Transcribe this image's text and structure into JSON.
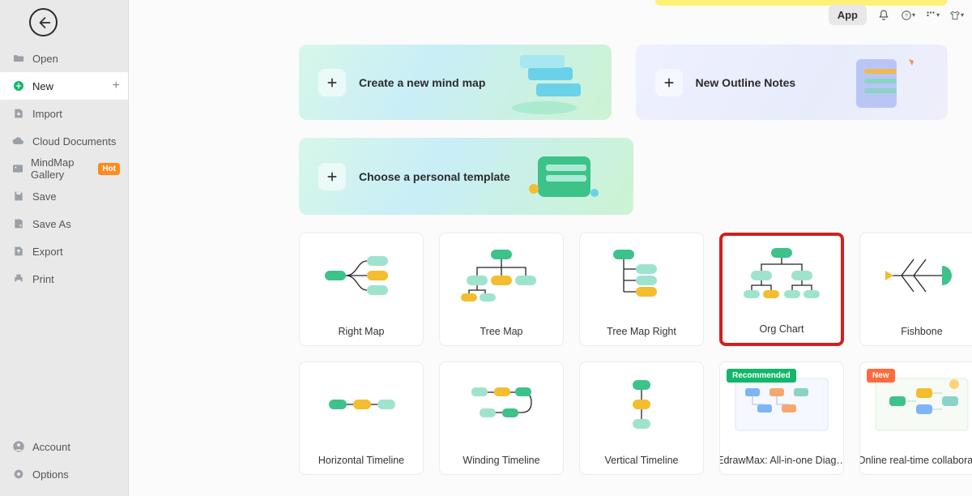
{
  "topbar": {
    "app_label": "App"
  },
  "sidebar": {
    "items": [
      {
        "label": "Open"
      },
      {
        "label": "New"
      },
      {
        "label": "Import"
      },
      {
        "label": "Cloud Documents"
      },
      {
        "label": "MindMap Gallery",
        "hot": "Hot"
      },
      {
        "label": "Save"
      },
      {
        "label": "Save As"
      },
      {
        "label": "Export"
      },
      {
        "label": "Print"
      }
    ],
    "bottom": [
      {
        "label": "Account"
      },
      {
        "label": "Options"
      }
    ]
  },
  "hero": {
    "mindmap": "Create a new mind map",
    "outline": "New Outline Notes",
    "template": "Choose a personal template"
  },
  "templates": [
    {
      "label": "Right Map"
    },
    {
      "label": "Tree Map"
    },
    {
      "label": "Tree Map Right"
    },
    {
      "label": "Org Chart",
      "highlight": true
    },
    {
      "label": "Fishbone"
    },
    {
      "label": "Horizontal Timeline"
    },
    {
      "label": "Winding Timeline"
    },
    {
      "label": "Vertical Timeline"
    },
    {
      "label": "EdrawMax: All-in-one Diag…",
      "badge": "Recommended",
      "badgeClass": "badge-rec"
    },
    {
      "label": "Online real-time collaborat…",
      "badge": "New",
      "badgeClass": "badge-new"
    }
  ]
}
